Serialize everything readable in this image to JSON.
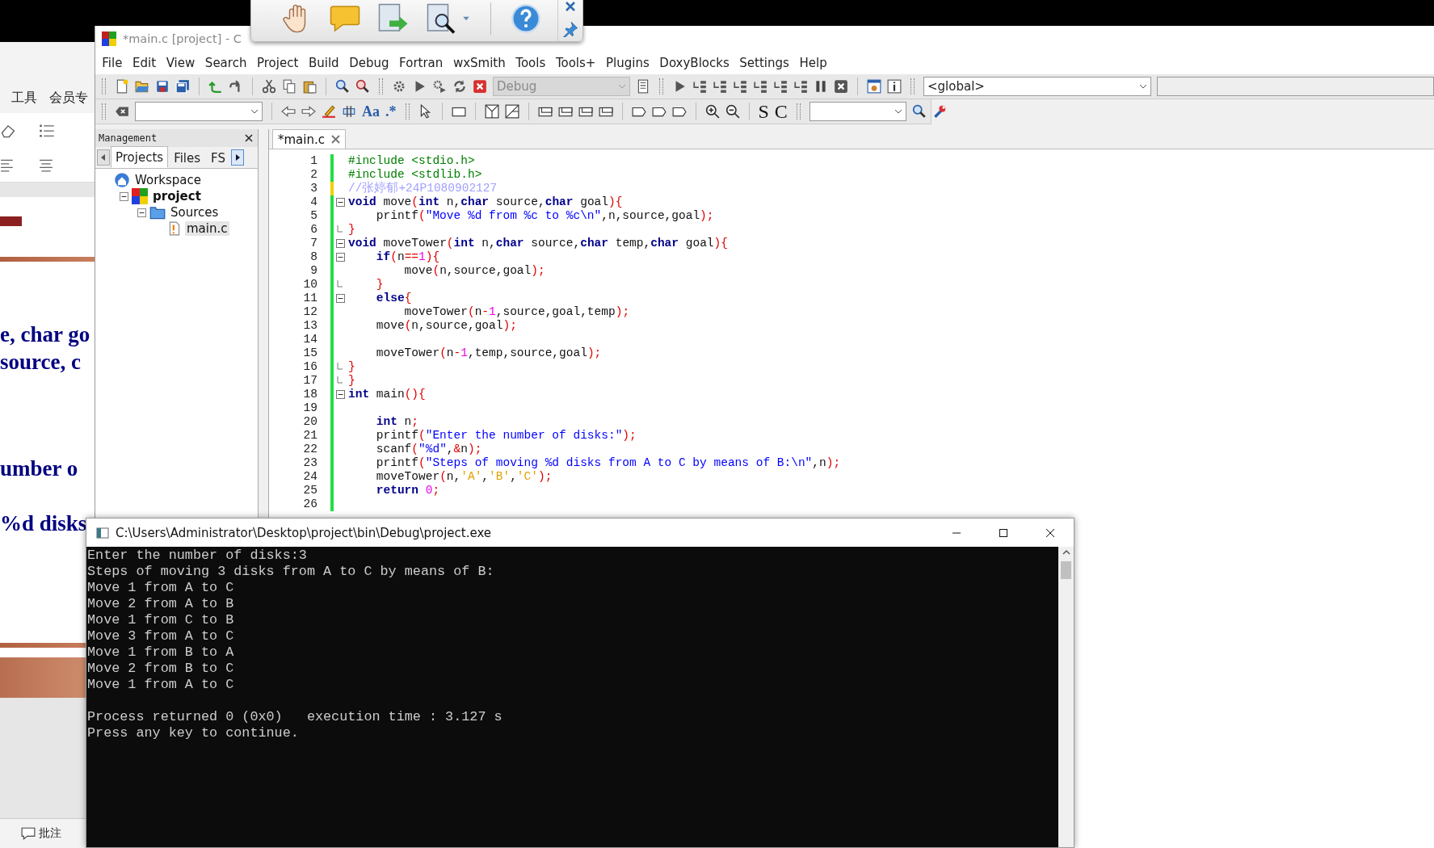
{
  "background_window": {
    "ribbon_tabs": [
      "工具",
      "会员专"
    ],
    "slide_lines": [
      "e, char go",
      "source, c",
      "umber o",
      "%d disks"
    ],
    "status_bar": {
      "comment_button": "批注"
    }
  },
  "ide": {
    "title": "*main.c [project] - C",
    "menu": [
      "File",
      "Edit",
      "View",
      "Search",
      "Project",
      "Build",
      "Debug",
      "Fortran",
      "wxSmith",
      "Tools",
      "Tools+",
      "Plugins",
      "DoxyBlocks",
      "Settings",
      "Help"
    ],
    "build_target": {
      "value": "Debug",
      "disabled": true
    },
    "scope": {
      "value": "<global>"
    },
    "search_toolbar": {
      "labels": [
        "Aa",
        ".*"
      ]
    },
    "code_completion": {
      "labels": [
        "S",
        "C"
      ]
    },
    "management": {
      "title": "Management",
      "tabs": [
        {
          "label": "Projects",
          "selected": true
        },
        {
          "label": "Files",
          "selected": false
        },
        {
          "label": "FS",
          "selected": false
        }
      ],
      "tree": [
        {
          "label": "Workspace",
          "kind": "workspace",
          "active": false,
          "selected": false,
          "children": [
            {
              "label": "project",
              "kind": "project",
              "active": true,
              "selected": false,
              "expanded": true,
              "children": [
                {
                  "label": "Sources",
                  "kind": "folder",
                  "active": false,
                  "selected": false,
                  "expanded": true,
                  "children": [
                    {
                      "label": "main.c",
                      "kind": "file",
                      "active": false,
                      "selected": true
                    }
                  ]
                }
              ]
            }
          ]
        }
      ]
    },
    "editor": {
      "tabs": [
        {
          "label": "*main.c",
          "selected": true
        }
      ],
      "lines": [
        {
          "number": "1",
          "modified": false,
          "fold_start": false,
          "fold_end": false,
          "tokens": [
            {
              "kind": "preprocessor",
              "text": "#include <stdio.h>"
            }
          ]
        },
        {
          "number": "2",
          "modified": false,
          "fold_start": false,
          "fold_end": false,
          "tokens": [
            {
              "kind": "preprocessor",
              "text": "#include <stdlib.h>"
            }
          ]
        },
        {
          "number": "3",
          "modified": true,
          "fold_start": false,
          "fold_end": false,
          "tokens": [
            {
              "kind": "comment",
              "text": "//张婷郁+24P1080902127"
            }
          ]
        },
        {
          "number": "4",
          "modified": false,
          "fold_start": true,
          "fold_end": false,
          "tokens": [
            {
              "kind": "keyword",
              "text": "void"
            },
            {
              "kind": "plain",
              "text": " move"
            },
            {
              "kind": "operator",
              "text": "("
            },
            {
              "kind": "keyword",
              "text": "int"
            },
            {
              "kind": "plain",
              "text": " n,"
            },
            {
              "kind": "keyword",
              "text": "char"
            },
            {
              "kind": "plain",
              "text": " source,"
            },
            {
              "kind": "keyword",
              "text": "char"
            },
            {
              "kind": "plain",
              "text": " goal"
            },
            {
              "kind": "operator",
              "text": "){"
            }
          ]
        },
        {
          "number": "5",
          "modified": false,
          "fold_start": false,
          "fold_end": false,
          "tokens": [
            {
              "kind": "plain",
              "text": "    printf"
            },
            {
              "kind": "operator",
              "text": "("
            },
            {
              "kind": "string",
              "text": "\"Move %d from %c to %c\\n\""
            },
            {
              "kind": "plain",
              "text": ",n,source,goal"
            },
            {
              "kind": "operator",
              "text": ");"
            }
          ]
        },
        {
          "number": "6",
          "modified": false,
          "fold_start": false,
          "fold_end": true,
          "tokens": [
            {
              "kind": "operator",
              "text": "}"
            }
          ]
        },
        {
          "number": "7",
          "modified": false,
          "fold_start": true,
          "fold_end": false,
          "tokens": [
            {
              "kind": "keyword",
              "text": "void"
            },
            {
              "kind": "plain",
              "text": " moveTower"
            },
            {
              "kind": "operator",
              "text": "("
            },
            {
              "kind": "keyword",
              "text": "int"
            },
            {
              "kind": "plain",
              "text": " n,"
            },
            {
              "kind": "keyword",
              "text": "char"
            },
            {
              "kind": "plain",
              "text": " source,"
            },
            {
              "kind": "keyword",
              "text": "char"
            },
            {
              "kind": "plain",
              "text": " temp,"
            },
            {
              "kind": "keyword",
              "text": "char"
            },
            {
              "kind": "plain",
              "text": " goal"
            },
            {
              "kind": "operator",
              "text": "){"
            }
          ]
        },
        {
          "number": "8",
          "modified": false,
          "fold_start": true,
          "fold_end": false,
          "tokens": [
            {
              "kind": "keyword",
              "text": "    if"
            },
            {
              "kind": "operator",
              "text": "("
            },
            {
              "kind": "plain",
              "text": "n"
            },
            {
              "kind": "operator",
              "text": "=="
            },
            {
              "kind": "number",
              "text": "1"
            },
            {
              "kind": "operator",
              "text": "){"
            }
          ]
        },
        {
          "number": "9",
          "modified": false,
          "fold_start": false,
          "fold_end": false,
          "tokens": [
            {
              "kind": "plain",
              "text": "        move"
            },
            {
              "kind": "operator",
              "text": "("
            },
            {
              "kind": "plain",
              "text": "n,source,goal"
            },
            {
              "kind": "operator",
              "text": ");"
            }
          ]
        },
        {
          "number": "10",
          "modified": false,
          "fold_start": false,
          "fold_end": true,
          "tokens": [
            {
              "kind": "operator",
              "text": "    }"
            }
          ]
        },
        {
          "number": "11",
          "modified": false,
          "fold_start": true,
          "fold_end": false,
          "tokens": [
            {
              "kind": "keyword",
              "text": "    else"
            },
            {
              "kind": "operator",
              "text": "{"
            }
          ]
        },
        {
          "number": "12",
          "modified": false,
          "fold_start": false,
          "fold_end": false,
          "tokens": [
            {
              "kind": "plain",
              "text": "        moveTower"
            },
            {
              "kind": "operator",
              "text": "("
            },
            {
              "kind": "plain",
              "text": "n"
            },
            {
              "kind": "operator",
              "text": "-"
            },
            {
              "kind": "number",
              "text": "1"
            },
            {
              "kind": "plain",
              "text": ",source,goal,temp"
            },
            {
              "kind": "operator",
              "text": ");"
            }
          ]
        },
        {
          "number": "13",
          "modified": false,
          "fold_start": false,
          "fold_end": false,
          "tokens": [
            {
              "kind": "plain",
              "text": "    move"
            },
            {
              "kind": "operator",
              "text": "("
            },
            {
              "kind": "plain",
              "text": "n,source,goal"
            },
            {
              "kind": "operator",
              "text": ");"
            }
          ]
        },
        {
          "number": "14",
          "modified": false,
          "fold_start": false,
          "fold_end": false
        },
        {
          "number": "15",
          "modified": false,
          "fold_start": false,
          "fold_end": false,
          "tokens": [
            {
              "kind": "plain",
              "text": "    moveTower"
            },
            {
              "kind": "operator",
              "text": "("
            },
            {
              "kind": "plain",
              "text": "n"
            },
            {
              "kind": "operator",
              "text": "-"
            },
            {
              "kind": "number",
              "text": "1"
            },
            {
              "kind": "plain",
              "text": ",temp,source,goal"
            },
            {
              "kind": "operator",
              "text": ");"
            }
          ]
        },
        {
          "number": "16",
          "modified": false,
          "fold_start": false,
          "fold_end": true,
          "tokens": [
            {
              "kind": "operator",
              "text": "}"
            }
          ]
        },
        {
          "number": "17",
          "modified": false,
          "fold_start": false,
          "fold_end": true,
          "tokens": [
            {
              "kind": "operator",
              "text": "}"
            }
          ]
        },
        {
          "number": "18",
          "modified": false,
          "fold_start": true,
          "fold_end": false,
          "tokens": [
            {
              "kind": "keyword",
              "text": "int"
            },
            {
              "kind": "plain",
              "text": " main"
            },
            {
              "kind": "operator",
              "text": "(){"
            }
          ]
        },
        {
          "number": "19",
          "modified": false,
          "fold_start": false,
          "fold_end": false
        },
        {
          "number": "20",
          "modified": false,
          "fold_start": false,
          "fold_end": false,
          "tokens": [
            {
              "kind": "keyword",
              "text": "    int"
            },
            {
              "kind": "plain",
              "text": " n"
            },
            {
              "kind": "operator",
              "text": ";"
            }
          ]
        },
        {
          "number": "21",
          "modified": false,
          "fold_start": false,
          "fold_end": false,
          "tokens": [
            {
              "kind": "plain",
              "text": "    printf"
            },
            {
              "kind": "operator",
              "text": "("
            },
            {
              "kind": "string",
              "text": "\"Enter the number of disks:\""
            },
            {
              "kind": "operator",
              "text": ");"
            }
          ]
        },
        {
          "number": "22",
          "modified": false,
          "fold_start": false,
          "fold_end": false,
          "tokens": [
            {
              "kind": "plain",
              "text": "    scanf"
            },
            {
              "kind": "operator",
              "text": "("
            },
            {
              "kind": "string",
              "text": "\"%d\""
            },
            {
              "kind": "plain",
              "text": ","
            },
            {
              "kind": "operator",
              "text": "&"
            },
            {
              "kind": "plain",
              "text": "n"
            },
            {
              "kind": "operator",
              "text": ");"
            }
          ]
        },
        {
          "number": "23",
          "modified": false,
          "fold_start": false,
          "fold_end": false,
          "tokens": [
            {
              "kind": "plain",
              "text": "    printf"
            },
            {
              "kind": "operator",
              "text": "("
            },
            {
              "kind": "string",
              "text": "\"Steps of moving %d disks from A to C by means of B:\\n\""
            },
            {
              "kind": "plain",
              "text": ",n"
            },
            {
              "kind": "operator",
              "text": ");"
            }
          ]
        },
        {
          "number": "24",
          "modified": false,
          "fold_start": false,
          "fold_end": false,
          "tokens": [
            {
              "kind": "plain",
              "text": "    moveTower"
            },
            {
              "kind": "operator",
              "text": "("
            },
            {
              "kind": "plain",
              "text": "n,"
            },
            {
              "kind": "character",
              "text": "'A'"
            },
            {
              "kind": "plain",
              "text": ","
            },
            {
              "kind": "character",
              "text": "'B'"
            },
            {
              "kind": "plain",
              "text": ","
            },
            {
              "kind": "character",
              "text": "'C'"
            },
            {
              "kind": "operator",
              "text": ");"
            }
          ]
        },
        {
          "number": "25",
          "modified": false,
          "fold_start": false,
          "fold_end": false,
          "tokens": [
            {
              "kind": "keyword",
              "text": "    return "
            },
            {
              "kind": "number",
              "text": "0"
            },
            {
              "kind": "operator",
              "text": ";"
            }
          ]
        },
        {
          "number": "26",
          "modified": false,
          "fold_start": false,
          "fold_end": false
        }
      ]
    }
  },
  "console": {
    "title": "C:\\Users\\Administrator\\Desktop\\project\\bin\\Debug\\project.exe",
    "output": [
      "Enter the number of disks:3",
      "Steps of moving 3 disks from A to C by means of B:",
      "Move 1 from A to C",
      "Move 2 from A to B",
      "Move 1 from C to B",
      "Move 3 from A to C",
      "Move 1 from B to A",
      "Move 2 from B to C",
      "Move 1 from A to C"
    ],
    "status": [
      "Process returned 0 (0x0)   execution time : 3.127 s",
      "Press any key to continue."
    ]
  }
}
